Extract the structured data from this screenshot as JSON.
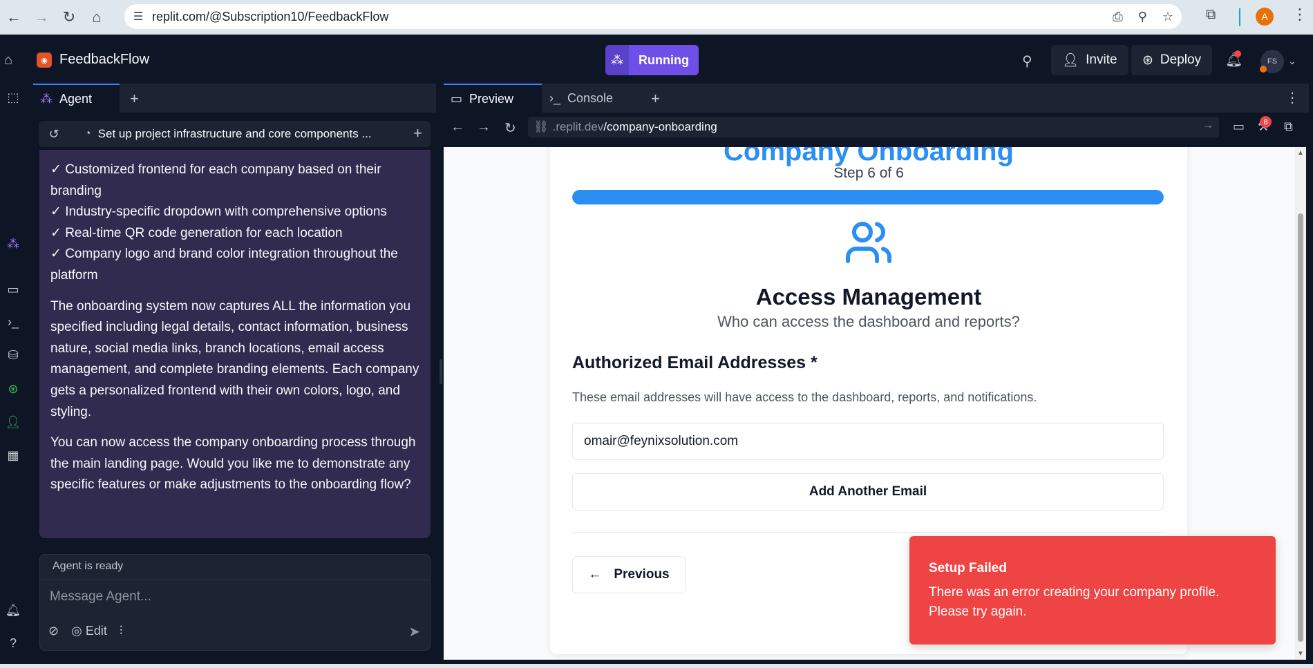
{
  "browser": {
    "url": "replit.com/@Subscription10/FeedbackFlow",
    "profile_initial": "A"
  },
  "topbar": {
    "app_name": "FeedbackFlow",
    "run_status": "Running",
    "invite_label": "Invite",
    "deploy_label": "Deploy",
    "avatar_initials": "FS"
  },
  "agent": {
    "tab_label": "Agent",
    "task_title": "Set up project infrastructure and core components ...",
    "message": {
      "checklist": [
        "✓ Customized frontend for each company based on their branding",
        "✓ Industry-specific dropdown with comprehensive options",
        "✓ Real-time QR code generation for each location",
        "✓ Company logo and brand color integration throughout the platform"
      ],
      "paragraph1": "The onboarding system now captures ALL the information you specified including legal details, contact information, business nature, social media links, branch locations, email access management, and complete branding elements. Each company gets a personalized frontend with their own colors, logo, and styling.",
      "paragraph2": "You can now access the company onboarding process through the main landing page. Would you like me to demonstrate any specific features or make adjustments to the onboarding flow?"
    },
    "status": "Agent is ready",
    "input_placeholder": "Message Agent...",
    "edit_label": "Edit"
  },
  "preview": {
    "tab_preview": "Preview",
    "tab_console": "Console",
    "url_domain": ".replit.dev",
    "url_path": "/company-onboarding",
    "devtools_badge": "8",
    "page": {
      "title": "Company Onboarding",
      "step_text": "Step 6 of 6",
      "progress": 1.0,
      "section_title": "Access Management",
      "section_subtitle": "Who can access the dashboard and reports?",
      "field_label": "Authorized Email Addresses *",
      "field_help": "These email addresses will have access to the dashboard, reports, and notifications.",
      "email_value": "omair@feynixsolution.com",
      "add_email_label": "Add Another Email",
      "previous_label": "Previous"
    },
    "toast": {
      "title": "Setup Failed",
      "message": "There was an error creating your company profile. Please try again."
    }
  },
  "colors": {
    "accent": "#2b8ef2",
    "error": "#ef4444",
    "running": "#6e4fe8"
  }
}
